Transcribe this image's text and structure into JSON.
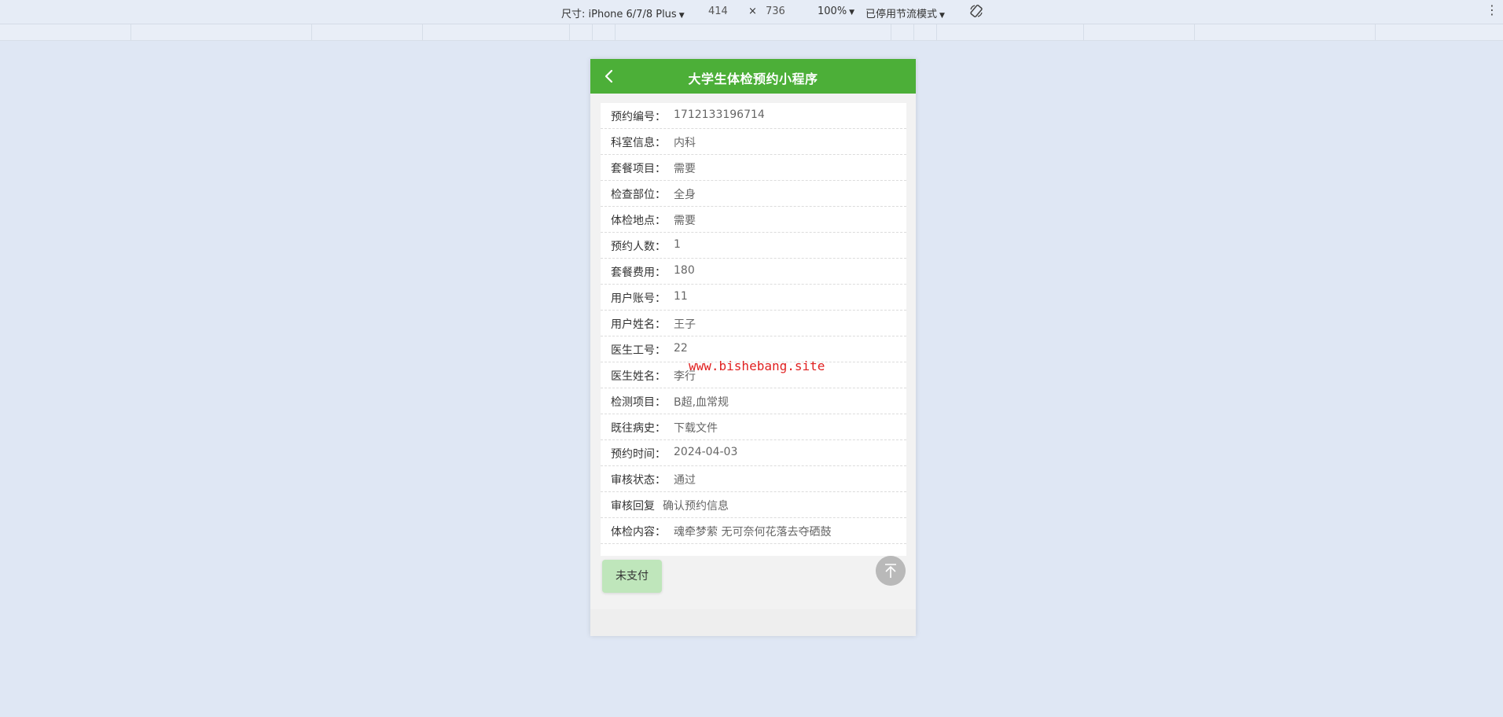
{
  "devtools": {
    "device_label": "尺寸: iPhone 6/7/8 Plus",
    "width": "414",
    "times": "×",
    "height": "736",
    "zoom": "100%",
    "throttle": "已停用节流模式",
    "rotate_icon": "rotate-icon",
    "more_icon": "more-vert-icon"
  },
  "app": {
    "title": "大学生体检预约小程序",
    "back_icon": "chevron-left-icon"
  },
  "details": [
    {
      "label": "预约编号：",
      "value": "1712133196714"
    },
    {
      "label": "科室信息：",
      "value": "内科"
    },
    {
      "label": "套餐项目：",
      "value": "需要"
    },
    {
      "label": "检查部位：",
      "value": "全身"
    },
    {
      "label": "体检地点：",
      "value": "需要"
    },
    {
      "label": "预约人数：",
      "value": "1"
    },
    {
      "label": "套餐费用：",
      "value": "180"
    },
    {
      "label": "用户账号：",
      "value": "11"
    },
    {
      "label": "用户姓名：",
      "value": "王子"
    },
    {
      "label": "医生工号：",
      "value": "22"
    },
    {
      "label": "医生姓名：",
      "value": "李行"
    },
    {
      "label": "检测项目：",
      "value": "B超,血常规"
    },
    {
      "label": "既往病史：",
      "value": "下载文件"
    },
    {
      "label": "预约时间：",
      "value": "2024-04-03"
    },
    {
      "label": "审核状态：",
      "value": "通过"
    },
    {
      "label": "审核回复",
      "value": "确认预约信息"
    },
    {
      "label": "体检内容：",
      "value": "魂牵梦萦 无可奈何花落去夺硒鼓"
    }
  ],
  "actions": {
    "pay_label": "未支付",
    "top_icon": "arrow-up-to-top-icon"
  },
  "watermark": "www.bishebang.site",
  "colors": {
    "navbar": "#4caf38",
    "pay_button": "#bfe6bb",
    "watermark": "#e02020"
  }
}
